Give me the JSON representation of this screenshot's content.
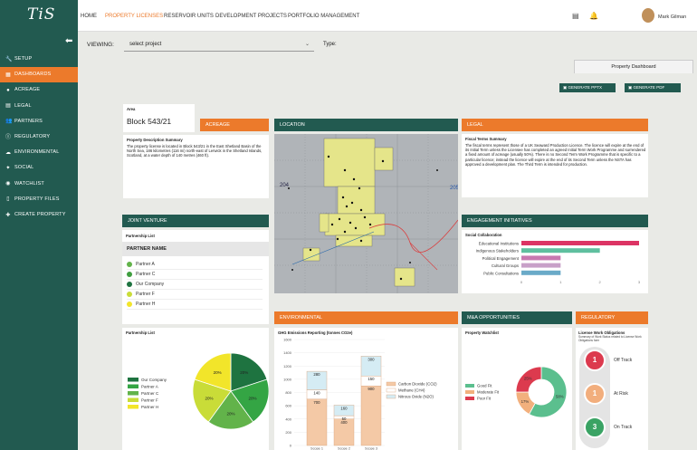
{
  "app": {
    "logo": "TiS"
  },
  "sidebar": {
    "items": [
      {
        "label": "SETUP",
        "icon": "wrench-icon",
        "glyph": "🔧"
      },
      {
        "label": "DASHBOARDS",
        "icon": "dashboard-icon",
        "glyph": "▦",
        "active": true
      },
      {
        "label": "ACREAGE",
        "icon": "map-pin-icon",
        "glyph": "●"
      },
      {
        "label": "LEGAL",
        "icon": "gavel-icon",
        "glyph": "▤"
      },
      {
        "label": "PARTNERS",
        "icon": "people-icon",
        "glyph": "👥"
      },
      {
        "label": "REGULATORY",
        "icon": "alert-circle-icon",
        "glyph": "ⓘ"
      },
      {
        "label": "ENVIRONMENTAL",
        "icon": "cloud-icon",
        "glyph": "☁"
      },
      {
        "label": "SOCIAL",
        "icon": "handshake-icon",
        "glyph": "✦"
      },
      {
        "label": "WATCHLIST",
        "icon": "binoculars-icon",
        "glyph": "◉"
      },
      {
        "label": "PROPERTY FILES",
        "icon": "file-icon",
        "glyph": "▯"
      },
      {
        "label": "CREATE PROPERTY",
        "icon": "add-location-icon",
        "glyph": "✚"
      }
    ]
  },
  "topnav": {
    "items": [
      "HOME",
      "PROPERTY LICENSES",
      "RESERVOIR UNITS",
      "DEVELOPMENT PROJECTS",
      "PORTFOLIO MANAGEMENT"
    ],
    "user": "Mark Gilman"
  },
  "viewing": {
    "label": "VIEWING:",
    "select": "select project",
    "type_label": "Type:"
  },
  "tab": "Property Dashboard",
  "buttons": {
    "pptx": "GENERATE PPTX",
    "pdf": "GENERATE PDF"
  },
  "area": {
    "label": "Area",
    "value": "Block 543/21"
  },
  "acreage": {
    "title": "ACREAGE",
    "summary_title": "Property Description Summary",
    "summary": "The property license is located in Block 543/21 in the East Shetland Basin of the North Sea, 186 kilometres (116 mi) north-east of Lerwick in the Shetland Islands, Scotland, at a water depth of 140 metres (460 ft)."
  },
  "location": {
    "title": "LOCATION",
    "labels": [
      "204",
      "205"
    ]
  },
  "legal": {
    "title": "LEGAL",
    "summary_title": "Fiscal Terms Summary",
    "summary": "The fiscal terms represent those of a UK Seaward Production Licence. The licence will expire at the end of its Initial Term unless the Licensee has completed an agreed Initial Term Work Programme and surrendered a fixed amount of acreage (usually 50%). There is no Second Term Work Programme that is specific to a particular licence; instead the licence will expire at the end of its Second Term unless the NSTA has approved a development plan. The Third Term is intended for production."
  },
  "joint_venture": {
    "title": "JOINT VENTURE",
    "list_title": "Partnership List",
    "col": "PARTNER NAME",
    "partners": [
      {
        "name": "Partner A",
        "color": "#62b34a"
      },
      {
        "name": "Partner C",
        "color": "#3f9e3f"
      },
      {
        "name": "Our Company",
        "color": "#1e7340"
      },
      {
        "name": "Partner F",
        "color": "#c9dc38"
      },
      {
        "name": "Partner H",
        "color": "#f2e52a"
      }
    ]
  },
  "engagement": {
    "title": "ENGAGEMENT INITIATIVES",
    "chart_title": "Social Collaboration"
  },
  "environmental": {
    "title": "ENVIRONMENTAL",
    "chart_title": "GHG Emissions Reporting (tonnes CO2e)"
  },
  "mna": {
    "title": "M&A OPPORTUNITIES",
    "chart_title": "Property Watchlist"
  },
  "regulatory": {
    "title": "REGULATORY",
    "chart_title": "License Work Obligations",
    "subtitle": "Summary of Work Status related to License Work Obligations form",
    "items": [
      {
        "count": "1",
        "label": "Off Track",
        "color": "#dc3a4e"
      },
      {
        "count": "1",
        "label": "At Risk",
        "color": "#f2ae7d"
      },
      {
        "count": "3",
        "label": "On Track",
        "color": "#3aa364"
      }
    ]
  },
  "partnership_chart": {
    "title": "Partnership List"
  },
  "chart_data": [
    {
      "type": "bar",
      "orientation": "horizontal",
      "title": "Social Collaboration",
      "categories": [
        "Educational Institutions",
        "Indigenous Stakeholders",
        "Political Engagement",
        "Cultural Groups",
        "Public Consultations"
      ],
      "values": [
        3,
        2,
        1,
        1,
        1
      ],
      "colors": [
        "#dc3464",
        "#5fbf9f",
        "#c878b0",
        "#c8a0c8",
        "#6aaac8"
      ],
      "xlim": [
        0,
        3
      ],
      "xticks": [
        "0",
        "1",
        "2",
        "3"
      ]
    },
    {
      "type": "bar",
      "stacked": true,
      "title": "GHG Emissions Reporting (tonnes CO2e)",
      "categories": [
        "Scope 1",
        "Scope 2",
        "Scope 3"
      ],
      "series": [
        {
          "name": "Carbon Dioxide (CO2)",
          "values": [
            700,
            400,
            900
          ],
          "color": "#f4c9a6"
        },
        {
          "name": "Methane (CH4)",
          "values": [
            140,
            50,
            150
          ],
          "color": "#ffffff"
        },
        {
          "name": "Nitrous Oxide (N2O)",
          "values": [
            280,
            160,
            300
          ],
          "color": "#d5ecf4"
        }
      ],
      "labels": [
        [
          "700",
          "140",
          "280"
        ],
        [
          "400",
          "50",
          "160"
        ],
        [
          "900",
          "150",
          "300"
        ]
      ],
      "ylim": [
        0,
        1600
      ],
      "yticks": [
        "0",
        "200",
        "400",
        "600",
        "800",
        "1000",
        "1200",
        "1400",
        "1600"
      ]
    },
    {
      "type": "pie",
      "donut": true,
      "title": "Property Watchlist",
      "labels": [
        "Good Fit",
        "Moderate Fit",
        "Poor Fit"
      ],
      "values": [
        58,
        17,
        25
      ],
      "colors": [
        "#5bbf8e",
        "#f2b07d",
        "#dc3a4e"
      ],
      "value_labels": [
        "58%",
        "17%",
        "25%"
      ]
    },
    {
      "type": "pie",
      "title": "Partnership List",
      "labels": [
        "Our Company",
        "Partner A",
        "Partner C",
        "Partner F",
        "Partner H"
      ],
      "values": [
        20,
        20,
        20,
        20,
        20
      ],
      "colors": [
        "#1e7340",
        "#34a544",
        "#62b34a",
        "#c9dc38",
        "#f2e52a"
      ],
      "value_labels": [
        "20%",
        "20%",
        "20%",
        "20%",
        "20%"
      ]
    }
  ]
}
